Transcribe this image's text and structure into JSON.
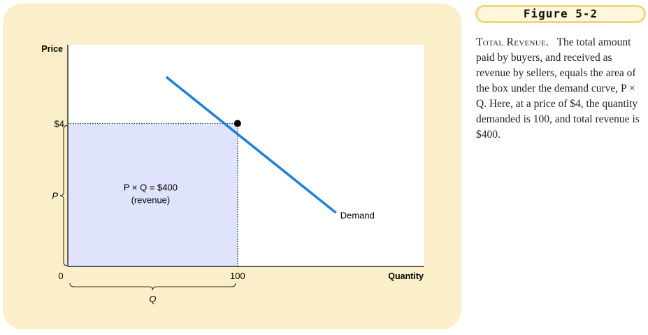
{
  "figure": {
    "label": "Figure 5-2",
    "caption_title": "Total Revenue.",
    "caption_body": "The total amount paid by buyers, and received as revenue by sellers, equals the area of the box under the demand curve, P × Q. Here, at a price of $4, the quantity demanded is 100, and total revenue is $400."
  },
  "chart_data": {
    "type": "line",
    "ylabel": "Price",
    "xlabel": "Quantity",
    "origin_label": "0",
    "x_ticks": [
      {
        "value": 100,
        "label": "100"
      }
    ],
    "y_ticks": [
      {
        "value": 4,
        "label": "$4"
      }
    ],
    "series": [
      {
        "name": "Demand",
        "color": "#1f7fd6",
        "points": [
          [
            58,
            5.3
          ],
          [
            158,
            1.5
          ]
        ]
      }
    ],
    "equilibrium": {
      "x": 100,
      "y": 4
    },
    "revenue_box": {
      "x": [
        0,
        100
      ],
      "y": [
        0,
        4
      ],
      "fill": "#dfe3fb",
      "label_line1": "P × Q = $400",
      "label_line2": "(revenue)"
    },
    "brace_labels": {
      "price": "P",
      "quantity": "Q"
    },
    "xlim": [
      0,
      210
    ],
    "ylim": [
      0,
      6.2
    ]
  }
}
